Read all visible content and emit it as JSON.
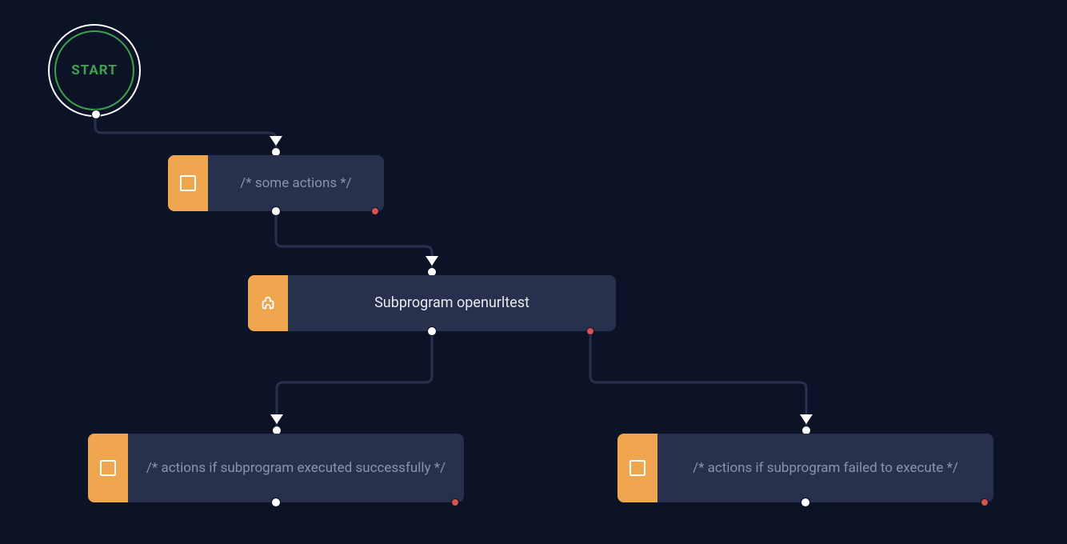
{
  "colors": {
    "background": "#0d1326",
    "block_bg": "#27304d",
    "block_accent": "#f0a64f",
    "text_muted": "#8a93ad",
    "text_solid": "#e8eaf0",
    "start_green": "#3fa34d",
    "port_white": "#ffffff",
    "port_red": "#d9534f",
    "connector": "#27304d"
  },
  "start": {
    "label": "START"
  },
  "nodes": {
    "actions1": {
      "icon": "stop-square-icon",
      "label": "/* some actions */"
    },
    "subprogram": {
      "icon": "puzzle-icon",
      "label": "Subprogram openurltest"
    },
    "success": {
      "icon": "stop-square-icon",
      "label": "/* actions if subprogram executed successfully */"
    },
    "failure": {
      "icon": "stop-square-icon",
      "label": "/* actions if subprogram failed to execute */"
    }
  },
  "edges": [
    {
      "from": "start",
      "to": "actions1"
    },
    {
      "from": "actions1",
      "to": "subprogram"
    },
    {
      "from": "subprogram.success",
      "to": "success"
    },
    {
      "from": "subprogram.failure",
      "to": "failure"
    }
  ]
}
